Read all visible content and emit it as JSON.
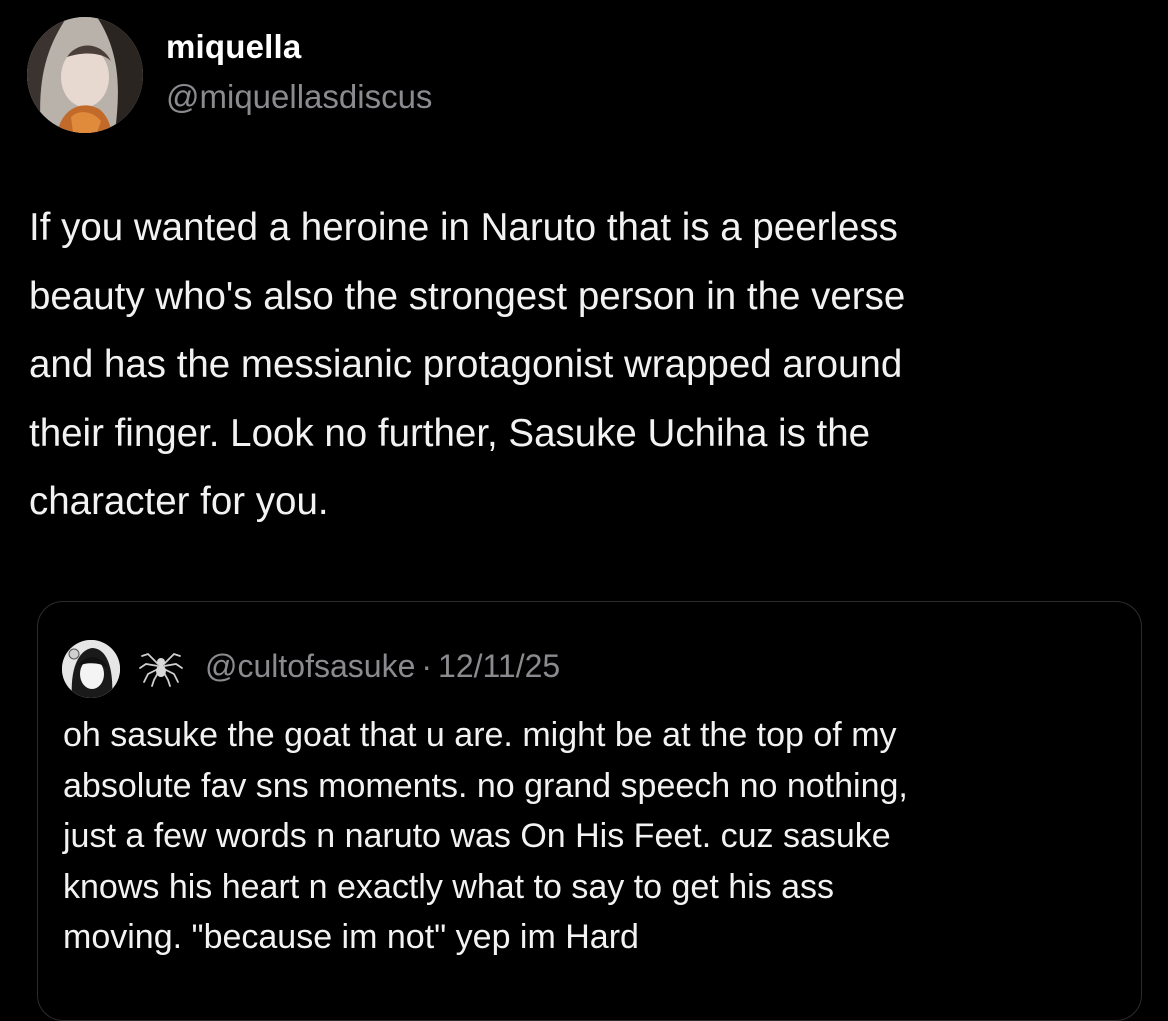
{
  "post": {
    "author": {
      "display_name": "miquella",
      "handle": "@miquellasdiscus",
      "avatar_icon": "profile-avatar"
    },
    "text": "If you wanted a heroine in Naruto that is a peerless\nbeauty who's also the strongest person in the verse\nand has the messianic protagonist wrapped around\ntheir finger. Look no further, Sasuke Uchiha is the\ncharacter for you."
  },
  "quoted_post": {
    "avatar_icon": "profile-avatar",
    "badge_icon": "spider-icon",
    "handle": "@cultofsasuke",
    "separator": "·",
    "date": "12/11/25",
    "text": "oh sasuke the goat that u are. might be at the top of my\nabsolute fav sns moments. no grand speech no nothing,\njust a few words n naruto was On His Feet. cuz sasuke\nknows his heart n exactly what to say to get his ass\nmoving. \"because im not\" yep im Hard"
  },
  "colors": {
    "background": "#000000",
    "primary_text": "#f2f2f2",
    "secondary_text": "#8b8b8f",
    "card_border": "#2c2c2e"
  }
}
